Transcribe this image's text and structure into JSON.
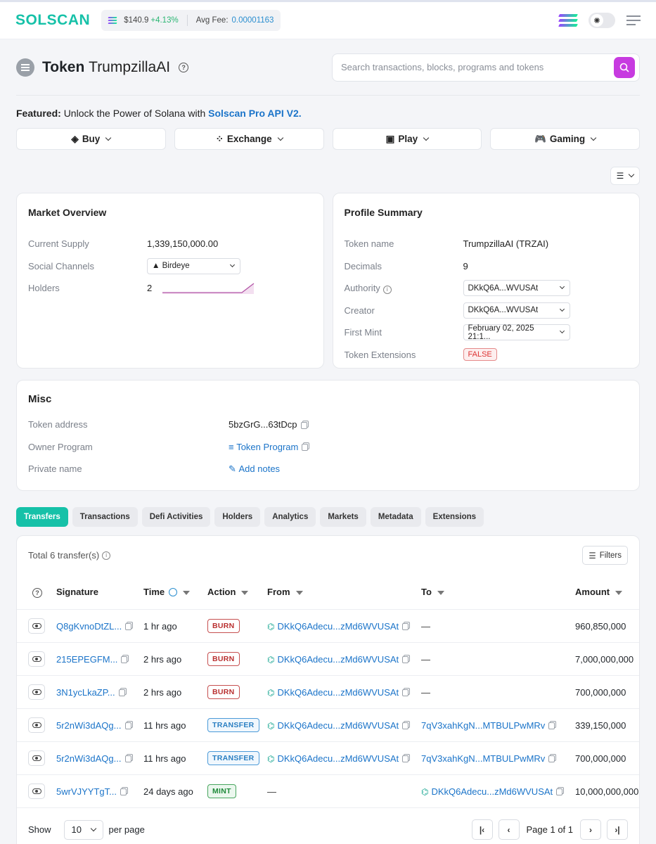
{
  "header": {
    "logo": "SOLSCAN",
    "sol_price": "$140.9",
    "sol_change": "+4.13%",
    "avg_fee_label": "Avg Fee:",
    "avg_fee_value": "0.00001163"
  },
  "title": {
    "prefix": "Token",
    "name": "TrumpzillaAI"
  },
  "search": {
    "placeholder": "Search transactions, blocks, programs and tokens"
  },
  "featured": {
    "label": "Featured:",
    "text": "Unlock the Power of Solana with",
    "link": "Solscan Pro API V2."
  },
  "categories": [
    {
      "label": "Buy",
      "icon": "buy-icon"
    },
    {
      "label": "Exchange",
      "icon": "exchange-icon"
    },
    {
      "label": "Play",
      "icon": "play-icon"
    },
    {
      "label": "Gaming",
      "icon": "gaming-icon"
    }
  ],
  "market": {
    "title": "Market Overview",
    "supply_label": "Current Supply",
    "supply_value": "1,339,150,000.00",
    "social_label": "Social Channels",
    "social_value": "Birdeye",
    "holders_label": "Holders",
    "holders_value": "2"
  },
  "profile": {
    "title": "Profile Summary",
    "name_label": "Token name",
    "name_value": "TrumpzillaAI (TRZAI)",
    "decimals_label": "Decimals",
    "decimals_value": "9",
    "authority_label": "Authority",
    "authority_value": "DKkQ6A...WVUSAt",
    "creator_label": "Creator",
    "creator_value": "DKkQ6A...WVUSAt",
    "mint_label": "First Mint",
    "mint_value": "February 02, 2025 21:1...",
    "ext_label": "Token Extensions",
    "ext_value": "FALSE"
  },
  "misc": {
    "title": "Misc",
    "address_label": "Token address",
    "address_value": "5bzGrG...63tDcp",
    "owner_label": "Owner Program",
    "owner_value": "Token Program",
    "private_label": "Private name",
    "private_value": "Add notes"
  },
  "tabs": [
    "Transfers",
    "Transactions",
    "Defi Activities",
    "Holders",
    "Analytics",
    "Markets",
    "Metadata",
    "Extensions"
  ],
  "transfers": {
    "total": "Total 6 transfer(s)",
    "filters_label": "Filters",
    "columns": {
      "signature": "Signature",
      "time": "Time",
      "action": "Action",
      "from": "From",
      "to": "To",
      "amount": "Amount"
    },
    "rows": [
      {
        "signature": "Q8gKvnoDtZL...",
        "time": "1 hr ago",
        "action": "BURN",
        "from": "DKkQ6Adecu...zMd6WVUSAt",
        "to": "—",
        "amount": "960,850,000"
      },
      {
        "signature": "215EPEGFM...",
        "time": "2 hrs ago",
        "action": "BURN",
        "from": "DKkQ6Adecu...zMd6WVUSAt",
        "to": "—",
        "amount": "7,000,000,000"
      },
      {
        "signature": "3N1ycLkaZP...",
        "time": "2 hrs ago",
        "action": "BURN",
        "from": "DKkQ6Adecu...zMd6WVUSAt",
        "to": "—",
        "amount": "700,000,000"
      },
      {
        "signature": "5r2nWi3dAQg...",
        "time": "11 hrs ago",
        "action": "TRANSFER",
        "from": "DKkQ6Adecu...zMd6WVUSAt",
        "to": "7qV3xahKgN...MTBULPwMRv",
        "amount": "339,150,000"
      },
      {
        "signature": "5r2nWi3dAQg...",
        "time": "11 hrs ago",
        "action": "TRANSFER",
        "from": "DKkQ6Adecu...zMd6WVUSAt",
        "to": "7qV3xahKgN...MTBULPwMRv",
        "amount": "700,000,000"
      },
      {
        "signature": "5wrVJYYTgT...",
        "time": "24 days ago",
        "action": "MINT",
        "from": "—",
        "to": "DKkQ6Adecu...zMd6WVUSAt",
        "amount": "10,000,000,000"
      }
    ],
    "show_label": "Show",
    "page_size": "10",
    "per_page_label": "per page",
    "page_label": "Page 1 of 1"
  },
  "colors": {
    "brand": "#16c1a8",
    "search_button": "#c73be0",
    "link": "#1b74c9"
  }
}
